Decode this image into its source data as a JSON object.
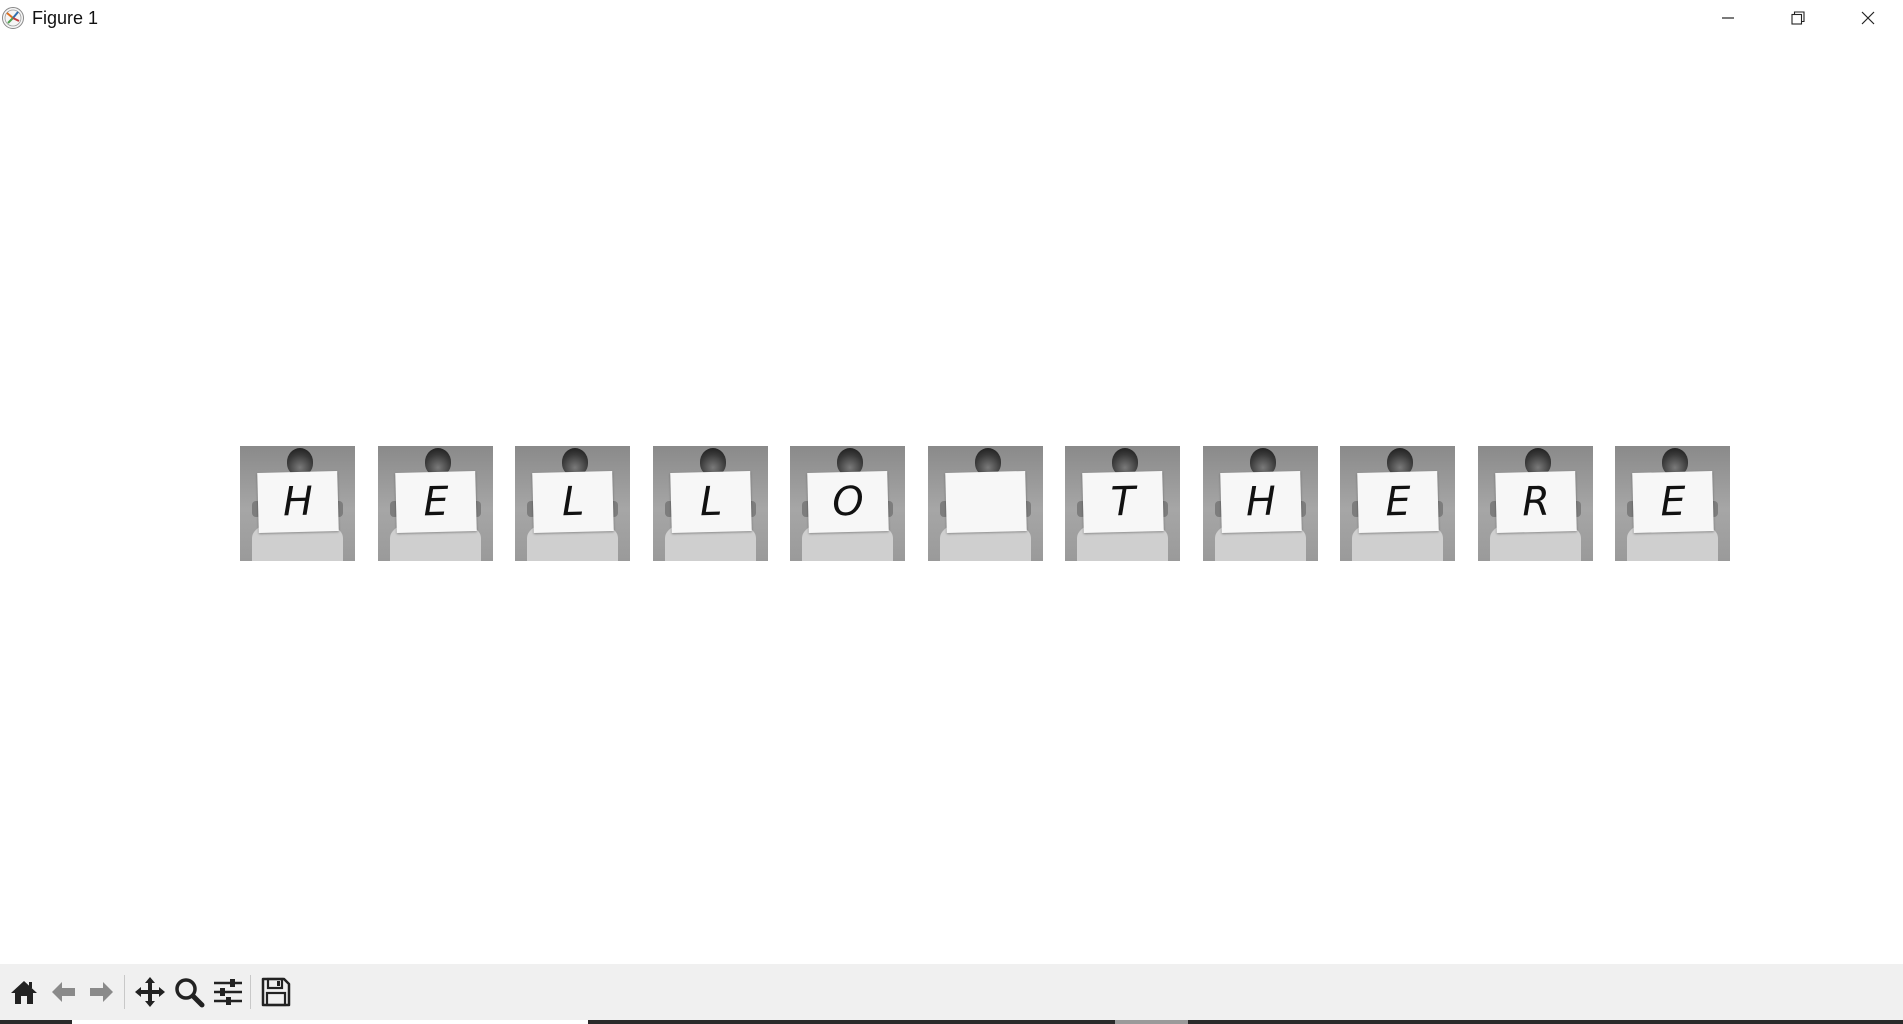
{
  "window": {
    "title": "Figure 1",
    "icon": "matplotlib-logo-icon",
    "controls": [
      "minimize-icon",
      "restore-icon",
      "close-icon"
    ]
  },
  "figure": {
    "images": [
      {
        "letter": "H"
      },
      {
        "letter": "E"
      },
      {
        "letter": "L"
      },
      {
        "letter": "L"
      },
      {
        "letter": "O"
      },
      {
        "letter": ""
      },
      {
        "letter": "T"
      },
      {
        "letter": "H"
      },
      {
        "letter": "E"
      },
      {
        "letter": "R"
      },
      {
        "letter": "E"
      }
    ]
  },
  "toolbar": {
    "buttons": [
      {
        "name": "home",
        "icon": "home-icon"
      },
      {
        "name": "back",
        "icon": "arrow-left-icon"
      },
      {
        "name": "forward",
        "icon": "arrow-right-icon"
      },
      {
        "name": "pan",
        "icon": "move-icon"
      },
      {
        "name": "zoom",
        "icon": "magnifier-icon"
      },
      {
        "name": "configure-subplots",
        "icon": "sliders-icon"
      },
      {
        "name": "save",
        "icon": "floppy-disk-icon"
      }
    ]
  },
  "colors": {
    "background": "#ffffff",
    "toolbar": "#f0f0f0",
    "icon": "#222222"
  }
}
